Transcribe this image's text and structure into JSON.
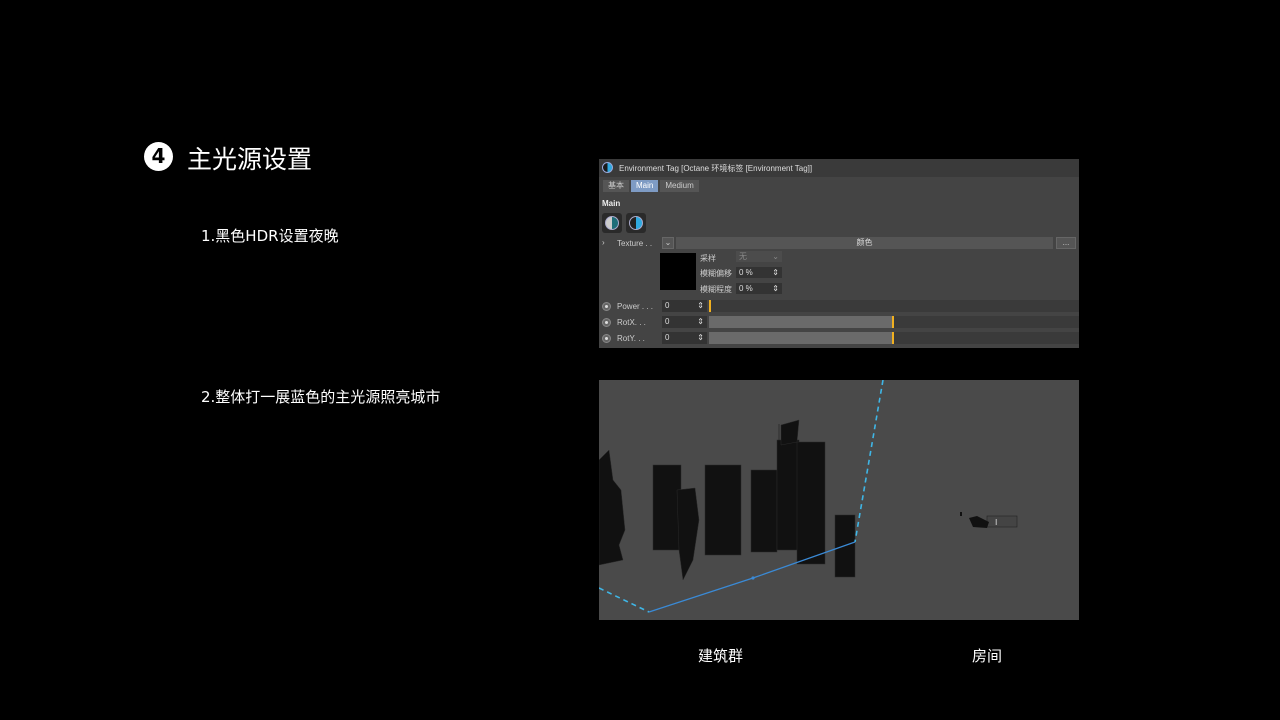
{
  "slide": {
    "step_number": "4",
    "title": "主光源设置",
    "note1": "1.黑色HDR设置夜晚",
    "note2": "2.整体打一展蓝色的主光源照亮城市",
    "caption_left": "建筑群",
    "caption_right": "房间"
  },
  "panel": {
    "title": "Environment Tag [Octane 环境标签 [Environment Tag]]",
    "tabs": [
      {
        "label": "基本",
        "active": false
      },
      {
        "label": "Main",
        "active": true
      },
      {
        "label": "Medium",
        "active": false
      }
    ],
    "section": "Main",
    "texture_label": "Texture . .",
    "texture_type": "颜色",
    "more_button": "...",
    "sampling_label": "采样",
    "sampling_value": "无",
    "blur_offset_label": "模糊偏移",
    "blur_offset_value": "0 %",
    "blur_amount_label": "模糊程度",
    "blur_amount_value": "0 %",
    "params": [
      {
        "label": "Power . . .",
        "value": "0",
        "level": 0.0
      },
      {
        "label": "RotX. . .",
        "value": "0",
        "level": 0.5
      },
      {
        "label": "RotY. . .",
        "value": "0",
        "level": 0.5
      }
    ],
    "accent_color": "#f0b020"
  },
  "viewport": {
    "background": "#4a4a4a",
    "light_line_color": "#3fb6e6"
  }
}
